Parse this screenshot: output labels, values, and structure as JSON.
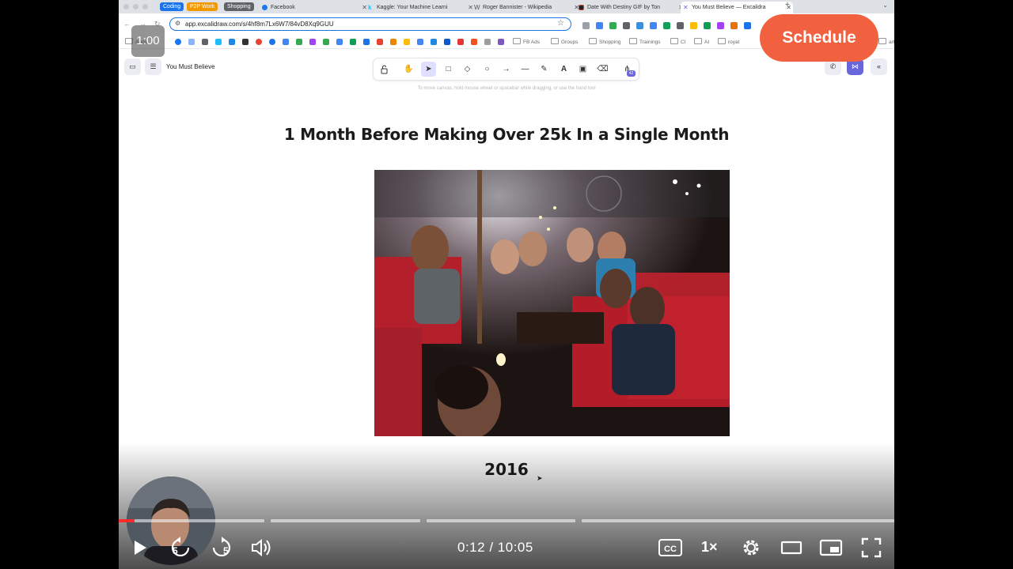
{
  "browser": {
    "tab_groups": [
      {
        "label": "Coding",
        "color": "#1a73e8"
      },
      {
        "label": "P2P Work",
        "color": "#f29900"
      },
      {
        "label": "Shopping",
        "color": "#5f6368"
      }
    ],
    "tabs": [
      {
        "title": "Facebook",
        "favicon_color": "#1877f2"
      },
      {
        "title": "Kaggle: Your Machine Learni",
        "favicon_color": "#20beff"
      },
      {
        "title": "Roger Bannister - Wikipedia",
        "favicon_color": "#888888"
      },
      {
        "title": "Date With Destiny GIF by Ton",
        "favicon_color": "#e03c31"
      },
      {
        "title": "You Must Believe — Excalidra",
        "favicon_color": "#6965db"
      }
    ],
    "new_tab_glyph": "+",
    "url": "app.excalidraw.com/s/4hf8m7Lx6W7/84vD8Xq9GUU",
    "bookmarks": {
      "apps_label": "Apps",
      "folders": [
        "FB Ads",
        "Groups",
        "Shopping",
        "Trainings",
        "CI",
        "AI",
        "royal"
      ],
      "all_bookmarks_tail": "arks"
    }
  },
  "excalidraw": {
    "document_title": "You Must Believe",
    "hint": "To move canvas, hold mouse wheel or spacebar while dragging, or use the hand tool",
    "library_badge": "42",
    "tools": [
      "lock-icon",
      "hand-icon",
      "selection-icon",
      "rectangle-icon",
      "diamond-icon",
      "ellipse-icon",
      "arrow-icon",
      "line-icon",
      "pencil-icon",
      "text-icon",
      "image-icon",
      "eraser-icon",
      "more-tools-icon"
    ],
    "canvas": {
      "heading": "1 Month Before Making Over 25k In a Single Month",
      "year": "2016"
    }
  },
  "overlay": {
    "schedule_label": "Schedule",
    "timer_label": "1:00"
  },
  "player": {
    "current_time": "0:12",
    "separator": "/",
    "duration": "10:05",
    "progress_fraction": 0.02,
    "skip_back_seconds": "5",
    "skip_forward_seconds": "5",
    "speed_label": "1×",
    "accent_color": "#ff2a2a"
  }
}
